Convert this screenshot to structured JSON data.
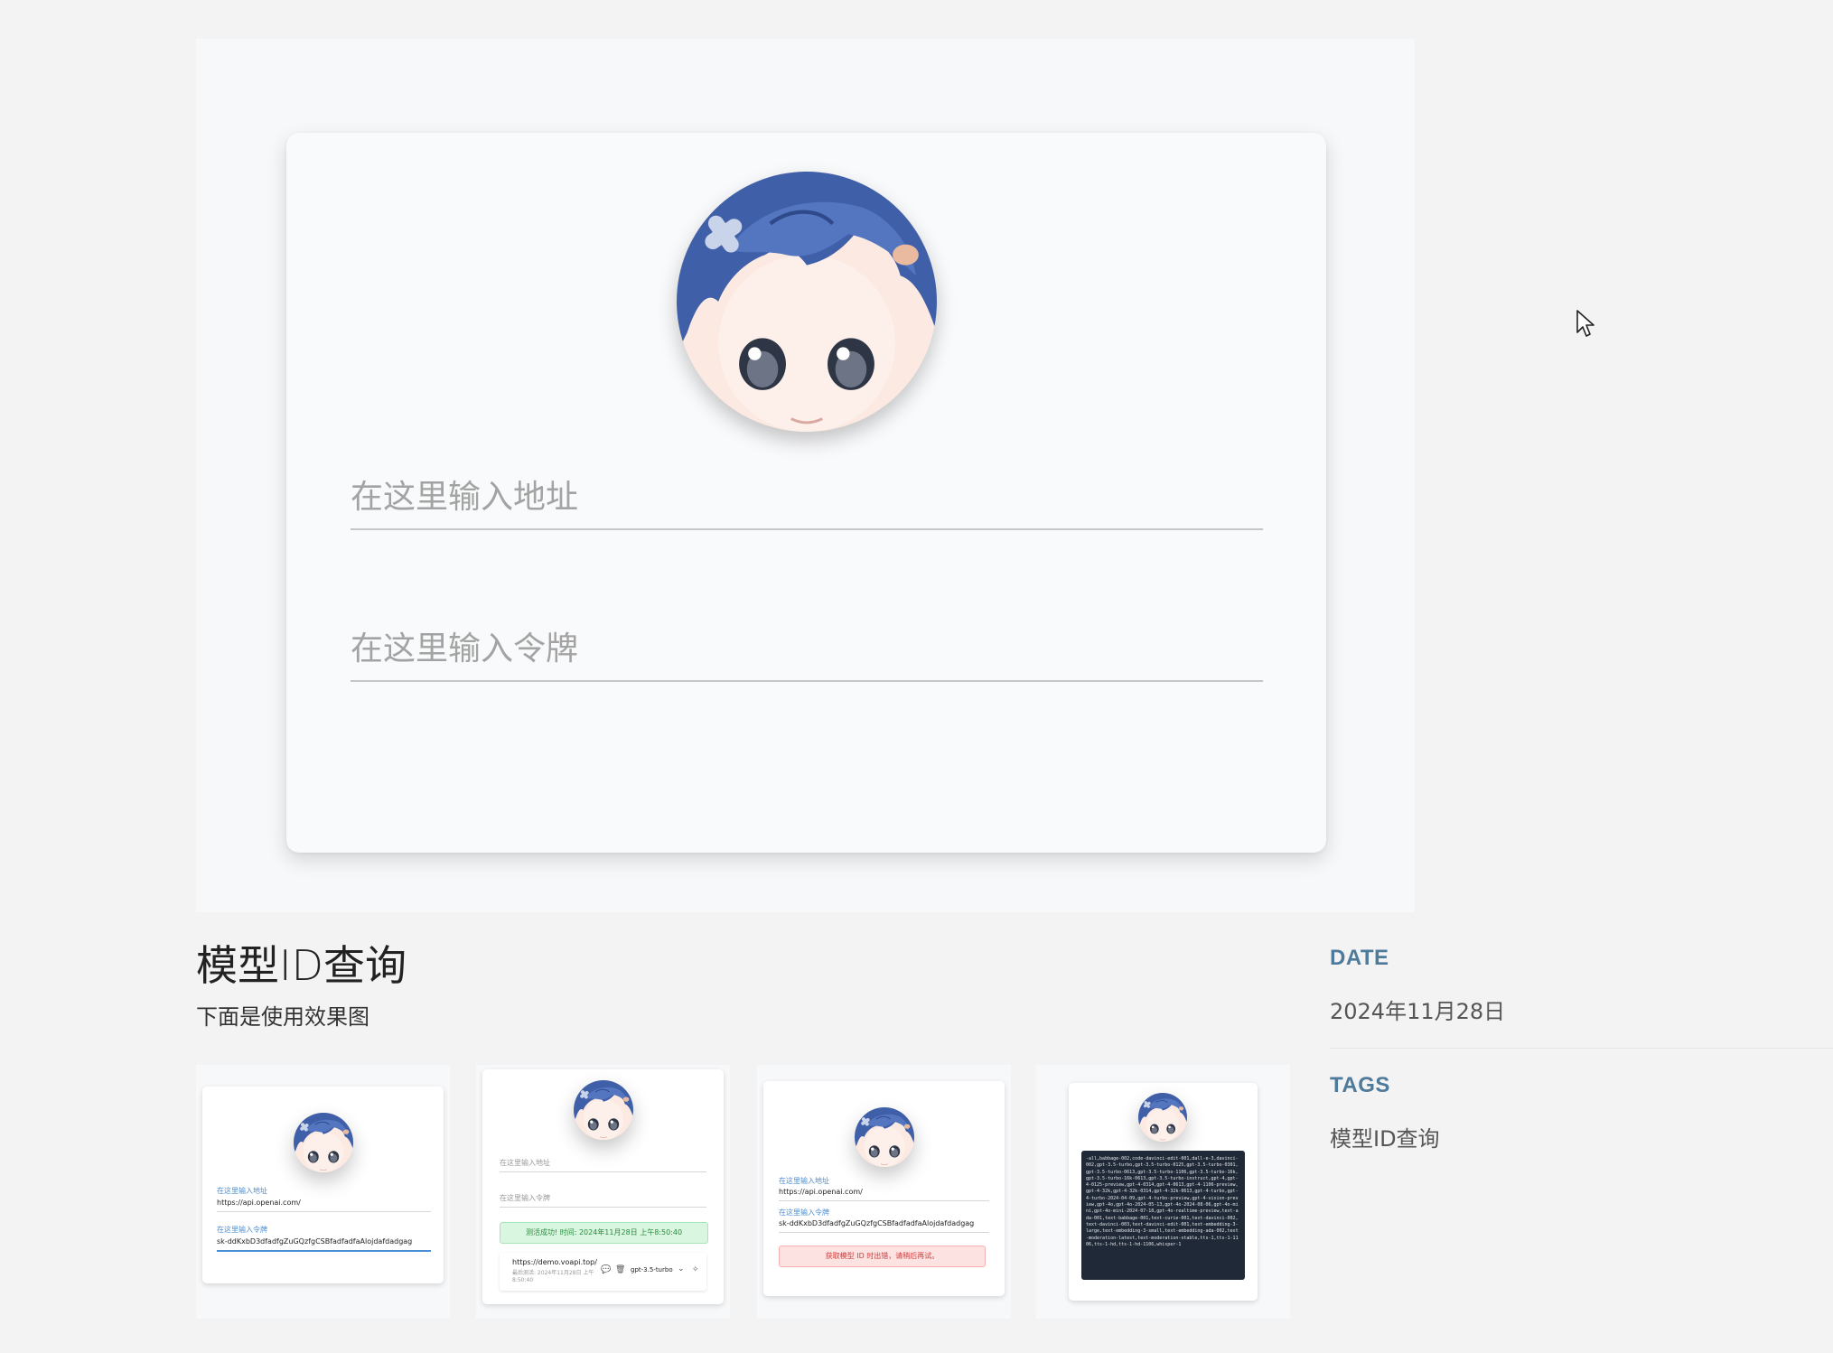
{
  "hero": {
    "address_placeholder": "在这里输入地址",
    "token_placeholder": "在这里输入令牌"
  },
  "post": {
    "title": "模型ID查询",
    "subtitle": "下面是使用效果图"
  },
  "meta": {
    "date_label": "DATE",
    "date_value": "2024年11月28日",
    "tags_label": "TAGS",
    "tag": "模型ID查询"
  },
  "thumbnails": {
    "one": {
      "address_label": "在这里输入地址",
      "address_value": "https://api.openai.com/",
      "token_label": "在这里输入令牌",
      "token_value": "sk-ddKxbD3dfadfgZuGQzfgCSBfadfadfaAlojdafdadgag"
    },
    "two": {
      "address_placeholder": "在这里输入地址",
      "token_placeholder": "在这里输入令牌",
      "success_text": "测活成功! 时间: 2024年11月28日 上午8:50:40",
      "row_url": "https://demo.voapi.top/",
      "row_time": "最后测活: 2024年11月28日 上午8:50:40",
      "model_select": "gpt-3.5-turbo"
    },
    "three": {
      "address_label": "在这里输入地址",
      "address_value": "https://api.openai.com/",
      "token_label": "在这里输入令牌",
      "token_value": "sk-ddKxbD3dfadfgZuGQzfgCSBfadfadfaAlojdafdadgag",
      "error_text": "获取模型 ID 时出错，请稍后再试。"
    },
    "four": {
      "model_list": "-all,babbage-002,code-davinci-edit-001,dall-e-3,davinci-002,gpt-3.5-turbo,gpt-3.5-turbo-0125,gpt-3.5-turbo-0301,gpt-3.5-turbo-0613,gpt-3.5-turbo-1106,gpt-3.5-turbo-16k,gpt-3.5-turbo-16k-0613,gpt-3.5-turbo-instruct,gpt-4,gpt-4-0125-preview,gpt-4-0314,gpt-4-0613,gpt-4-1106-preview,gpt-4-32k,gpt-4-32k-0314,gpt-4-32k-0613,gpt-4-turbo,gpt-4-turbo-2024-04-09,gpt-4-turbo-preview,gpt-4-vision-preview,gpt-4o,gpt-4o-2024-05-13,gpt-4o-2024-08-06,gpt-4o-mini,gpt-4o-mini-2024-07-18,gpt-4o-realtime-preview,text-ada-001,text-babbage-001,text-curie-001,text-davinci-002,text-davinci-003,text-davinci-edit-001,text-embedding-3-large,text-embedding-3-small,text-embedding-ada-002,text-moderation-latest,text-moderation-stable,tts-1,tts-1-1106,tts-1-hd,tts-1-hd-1106,whisper-1"
    }
  }
}
